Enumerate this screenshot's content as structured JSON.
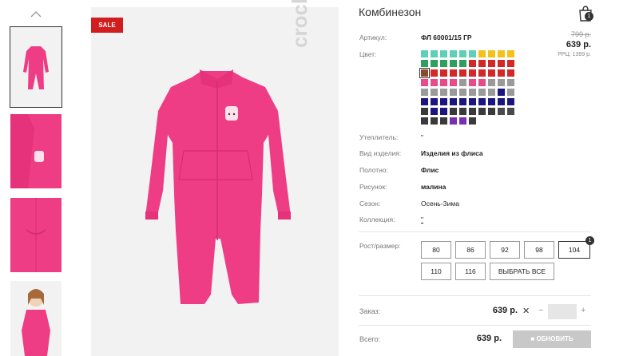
{
  "product": {
    "title": "Комбинезон",
    "sale_badge": "SALE",
    "brand": "crockid",
    "old_price": "799 р.",
    "price": "639 р.",
    "rrp": "РРЦ: 1399 р."
  },
  "cart": {
    "count": "1",
    "icon": "shopping-bag-icon"
  },
  "attributes": [
    {
      "label": "Артикул:",
      "value": "ФЛ 60001/15 ГР"
    },
    {
      "label": "Цвет:",
      "value": ""
    },
    {
      "label": "Утеплитель:",
      "value": "\""
    },
    {
      "label": "Вид изделия:",
      "value": "Изделия из флиса"
    },
    {
      "label": "Полотно:",
      "value": "Флис"
    },
    {
      "label": "Рисунок:",
      "value": "малина"
    },
    {
      "label": "Сезон:",
      "value": "Осень-Зима"
    },
    {
      "label": "Коллекция:",
      "value": "\""
    }
  ],
  "swatches": [
    "#5fcfb7",
    "#5fcfb7",
    "#5fcfb7",
    "#5fcfb7",
    "#5fcfb7",
    "#5fcfb7",
    "#f2c21b",
    "#f2c21b",
    "#f2c21b",
    "#f2c21b",
    "#2e9f5e",
    "#2e9f5e",
    "#2e9f5e",
    "#2e9f5e",
    "#2e9f5e",
    "#d22828",
    "#d22828",
    "#d22828",
    "#d22828",
    "#d22828",
    "#8a4a2c",
    "#d22828",
    "#d22828",
    "#d22828",
    "#d22828",
    "#d22828",
    "#d22828",
    "#d22828",
    "#d22828",
    "#d22828",
    "#e84a8a",
    "#e84a8a",
    "#e84a8a",
    "#e84a8a",
    "#9a9a9a",
    "#e84a8a",
    "#e84a8a",
    "#9a9a9a",
    "#9a9a9a",
    "#9a9a9a",
    "#9a9a9a",
    "#9a9a9a",
    "#9a9a9a",
    "#9a9a9a",
    "#9a9a9a",
    "#9a9a9a",
    "#9a9a9a",
    "#9a9a9a",
    "#1c1580",
    "#9a9a9a",
    "#1c1580",
    "#1c1580",
    "#1c1580",
    "#1c1580",
    "#1c1580",
    "#1c1580",
    "#1c1580",
    "#1c1580",
    "#1c1580",
    "#1c1580",
    "#3a3a3a",
    "#1c1580",
    "#1c1580",
    "#3a3a3a",
    "#3a3a3a",
    "#3a3a3a",
    "#3a3a3a",
    "#3a3a3a",
    "#4a4a4a",
    "#4a4a4a",
    "#3a3a3a",
    "#3a3a3a",
    "#3a3a3a",
    "#7a2fb0",
    "#7a2fb0",
    "#3a3a3a"
  ],
  "sizes": {
    "label": "Рост/размер:",
    "options": [
      "80",
      "86",
      "92",
      "98",
      "104",
      "110",
      "116"
    ],
    "all_label": "ВЫБРАТЬ ВСЕ",
    "selected": "104",
    "badge": "1"
  },
  "order": {
    "label": "Заказ:",
    "price": "639 р.",
    "remove": "✕",
    "minus": "−",
    "plus": "+",
    "quantity": ""
  },
  "total": {
    "label": "Всего:",
    "price": "639 р.",
    "update_label": "ОБНОВИТЬ"
  },
  "colors": {
    "sale": "#d11d1d",
    "garment": "#ee3d85"
  }
}
